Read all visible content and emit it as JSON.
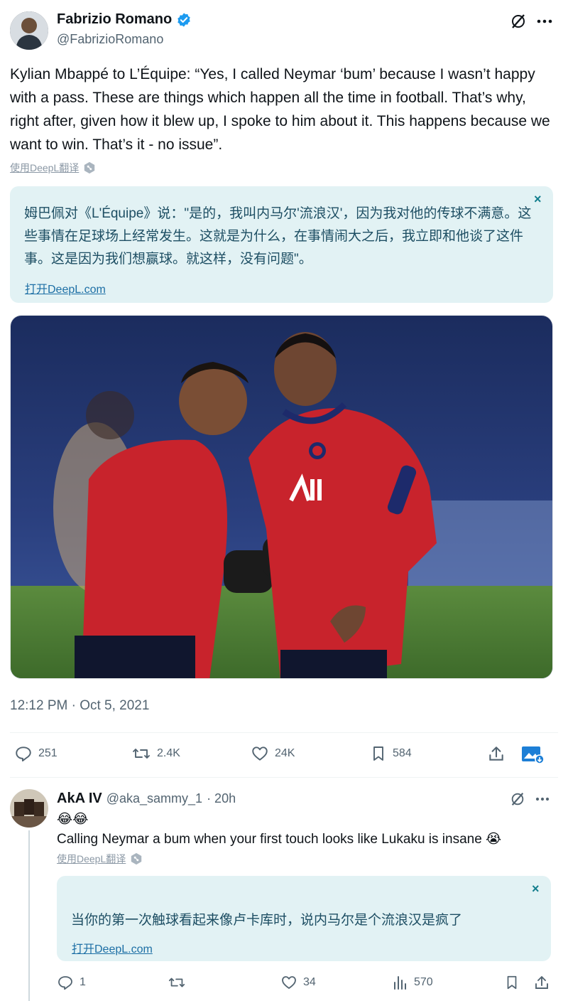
{
  "tweet": {
    "author_name": "Fabrizio Romano",
    "author_handle": "@FabrizioRomano",
    "text": "Kylian Mbappé to L’Équipe: “Yes, I called Neymar ‘bum’ because I wasn’t happy with a pass. These are things which happen all the time in football. That’s why, right after, given how it blew up, I spoke to him about it. This happens because we want to win. That’s it - no issue”.",
    "translate_label": "使用DeepL翻译",
    "translation": {
      "text": "姆巴佩对《L'Équipe》说：\"是的，我叫内马尔'流浪汉'，因为我对他的传球不满意。这些事情在足球场上经常发生。这就是为什么，在事情闹大之后，我立即和他谈了这件事。这是因为我们想赢球。就这样，没有问题\"。",
      "open_link": "打开DeepL.com",
      "close": "×"
    },
    "timestamp": "12:12 PM · Oct 5, 2021",
    "stats": {
      "replies": "251",
      "retweets": "2.4K",
      "likes": "24K",
      "bookmarks": "584"
    }
  },
  "reply": {
    "author_name": "AkA IV",
    "author_handle": "@aka_sammy_1",
    "time": "· 20h",
    "emoji_line": "😂😂",
    "text": "Calling Neymar a bum when your first touch looks like Lukaku is insane 😭",
    "translate_label": "使用DeepL翻译",
    "translation": {
      "text": "当你的第一次触球看起来像卢卡库时，说内马尔是个流浪汉是疯了",
      "open_link": "打开DeepL.com",
      "close": "×"
    },
    "stats": {
      "replies": "1",
      "likes": "34",
      "views": "570"
    }
  },
  "colors": {
    "verified": "#1d9bf0",
    "icon_gray": "#536471",
    "translation_bg": "#e2f2f4",
    "photo_red": "#c8232c"
  }
}
